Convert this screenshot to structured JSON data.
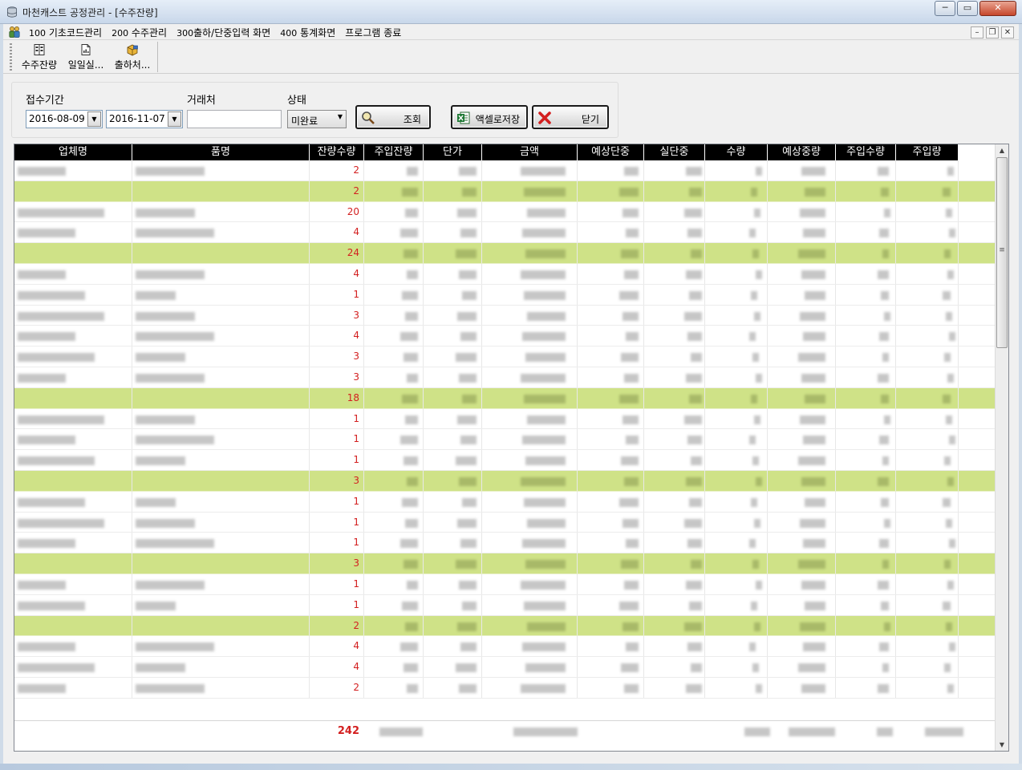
{
  "window": {
    "title": "마천캐스트 공정관리 - [수주잔량]",
    "minimize": "─",
    "maximize": "▭",
    "close": "✕"
  },
  "menu": {
    "items": [
      {
        "num": "100",
        "label": "기초코드관리"
      },
      {
        "num": "200",
        "label": "수주관리"
      },
      {
        "num": "300",
        "label": "출하/단중입력 화면"
      },
      {
        "num": "400",
        "label": "통계화면"
      },
      {
        "num": "",
        "label": "프로그램 종료"
      }
    ],
    "mdi_minimize": "–",
    "mdi_restore": "❐",
    "mdi_close": "✕"
  },
  "toolbar": {
    "buttons": [
      {
        "label": "수주잔량",
        "icon": "report-icon"
      },
      {
        "label": "일일실...",
        "icon": "document-icon"
      },
      {
        "label": "출하처...",
        "icon": "box-icon"
      }
    ]
  },
  "search": {
    "period_label": "접수기간",
    "date_from": "2016-08-09",
    "date_to": "2016-11-07",
    "client_label": "거래처",
    "client_value": "",
    "status_label": "상태",
    "status_value": "미완료",
    "search_button": "조회",
    "excel_button": "액셀로저장",
    "close_button": "닫기"
  },
  "grid": {
    "columns": [
      "업체명",
      "품명",
      "잔량수량",
      "주입잔량",
      "단가",
      "금액",
      "예상단중",
      "실단중",
      "수량",
      "예상중량",
      "주입수량",
      "주입량"
    ],
    "rows": [
      {
        "type": "item",
        "qty": "2"
      },
      {
        "type": "subtotal",
        "qty": "2"
      },
      {
        "type": "item",
        "qty": "20"
      },
      {
        "type": "item",
        "qty": "4"
      },
      {
        "type": "subtotal",
        "qty": "24"
      },
      {
        "type": "item",
        "qty": "4"
      },
      {
        "type": "item",
        "qty": "1"
      },
      {
        "type": "item",
        "qty": "3"
      },
      {
        "type": "item",
        "qty": "4"
      },
      {
        "type": "item",
        "qty": "3"
      },
      {
        "type": "item",
        "qty": "3"
      },
      {
        "type": "subtotal",
        "qty": "18"
      },
      {
        "type": "item",
        "qty": "1"
      },
      {
        "type": "item",
        "qty": "1"
      },
      {
        "type": "item",
        "qty": "1"
      },
      {
        "type": "subtotal",
        "qty": "3"
      },
      {
        "type": "item",
        "qty": "1"
      },
      {
        "type": "item",
        "qty": "1"
      },
      {
        "type": "item",
        "qty": "1"
      },
      {
        "type": "subtotal",
        "qty": "3"
      },
      {
        "type": "item",
        "qty": "1"
      },
      {
        "type": "item",
        "qty": "1"
      },
      {
        "type": "subtotal",
        "qty": "2"
      },
      {
        "type": "item",
        "qty": "4"
      },
      {
        "type": "item",
        "qty": "4"
      },
      {
        "type": "item",
        "qty": "2"
      }
    ],
    "total_qty": "242"
  }
}
